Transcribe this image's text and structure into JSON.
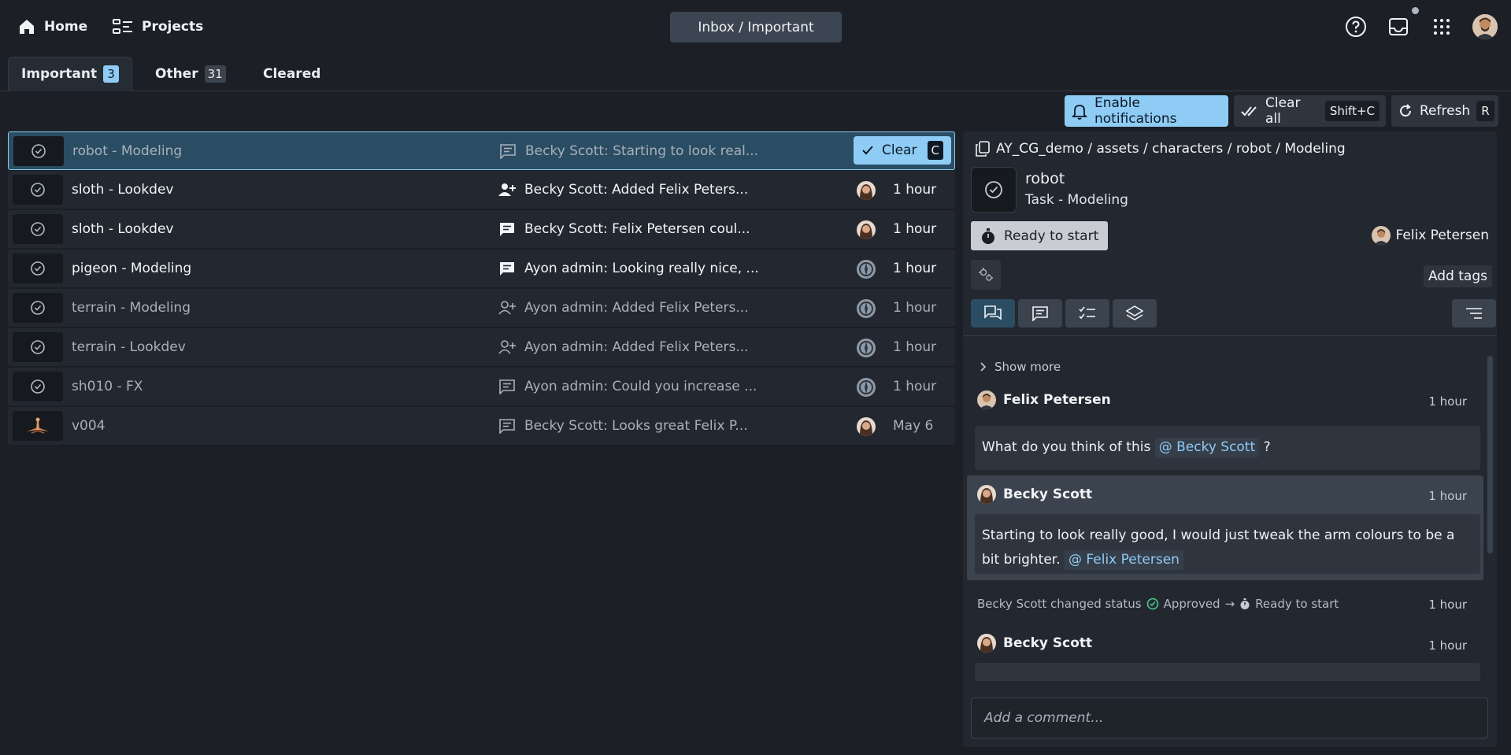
{
  "nav": {
    "home_label": "Home",
    "projects_label": "Projects",
    "title": "Inbox / Important"
  },
  "tabs": [
    {
      "label": "Important",
      "count": "3"
    },
    {
      "label": "Other",
      "count": "31"
    },
    {
      "label": "Cleared"
    }
  ],
  "toolbar": {
    "enable_notifications": "Enable notifications",
    "clear_all": "Clear all",
    "clear_all_key": "Shift+C",
    "refresh": "Refresh",
    "refresh_key": "R"
  },
  "rows": [
    {
      "title": "robot - Modeling",
      "message": "Becky Scott: Starting to look real...",
      "icon": "comment-icon",
      "selected": true,
      "clear_label": "Clear",
      "clear_key": "C"
    },
    {
      "title": "sloth - Lookdev",
      "message": "Becky Scott: Added Felix Peters...",
      "icon": "user-add-icon",
      "time": "1 hour",
      "avatar": "becky"
    },
    {
      "title": "sloth - Lookdev",
      "message": "Becky Scott: Felix Petersen coul...",
      "icon": "comment-icon",
      "time": "1 hour",
      "avatar": "becky"
    },
    {
      "title": "pigeon - Modeling",
      "message": "Ayon admin: Looking really nice, ...",
      "icon": "comment-icon",
      "time": "1 hour",
      "avatar": "admin"
    },
    {
      "title": "terrain - Modeling",
      "message": "Ayon admin: Added Felix Peters...",
      "icon": "user-add-icon",
      "time": "1 hour",
      "avatar": "admin"
    },
    {
      "title": "terrain - Lookdev",
      "message": "Ayon admin: Added Felix Peters...",
      "icon": "user-add-icon",
      "time": "1 hour",
      "avatar": "admin"
    },
    {
      "title": "sh010 - FX",
      "message": "Ayon admin: Could you increase ...",
      "icon": "comment-icon",
      "time": "1 hour",
      "avatar": "admin"
    },
    {
      "title": "v004",
      "message": "Becky Scott: Looks great Felix P...",
      "icon": "comment-icon",
      "time": "May 6",
      "avatar": "becky"
    }
  ],
  "details": {
    "breadcrumb": "AY_CG_demo / assets / characters / robot / Modeling",
    "entity_name": "robot",
    "entity_type": "Task -  Modeling",
    "status": "Ready to start",
    "assignee": "Felix Petersen",
    "add_tags": "Add tags",
    "show_more": "Show more",
    "comments": [
      {
        "author": "Felix Petersen",
        "time": "1 hour",
        "text": "What do you think of this",
        "mention": "@ Becky Scott",
        "suffix": "?"
      },
      {
        "author": "Becky Scott",
        "time": "1 hour",
        "text": "Starting to look really good, I would just tweak the arm colours to be a bit brighter.",
        "mention": "@ Felix Petersen"
      },
      {
        "author": "Becky Scott",
        "time": "1 hour"
      }
    ],
    "status_change": {
      "actor": "Becky Scott changed status",
      "from": "Approved",
      "arrow": "→",
      "to": "Ready to start",
      "time": "1 hour"
    },
    "comment_placeholder": "Add a comment..."
  }
}
